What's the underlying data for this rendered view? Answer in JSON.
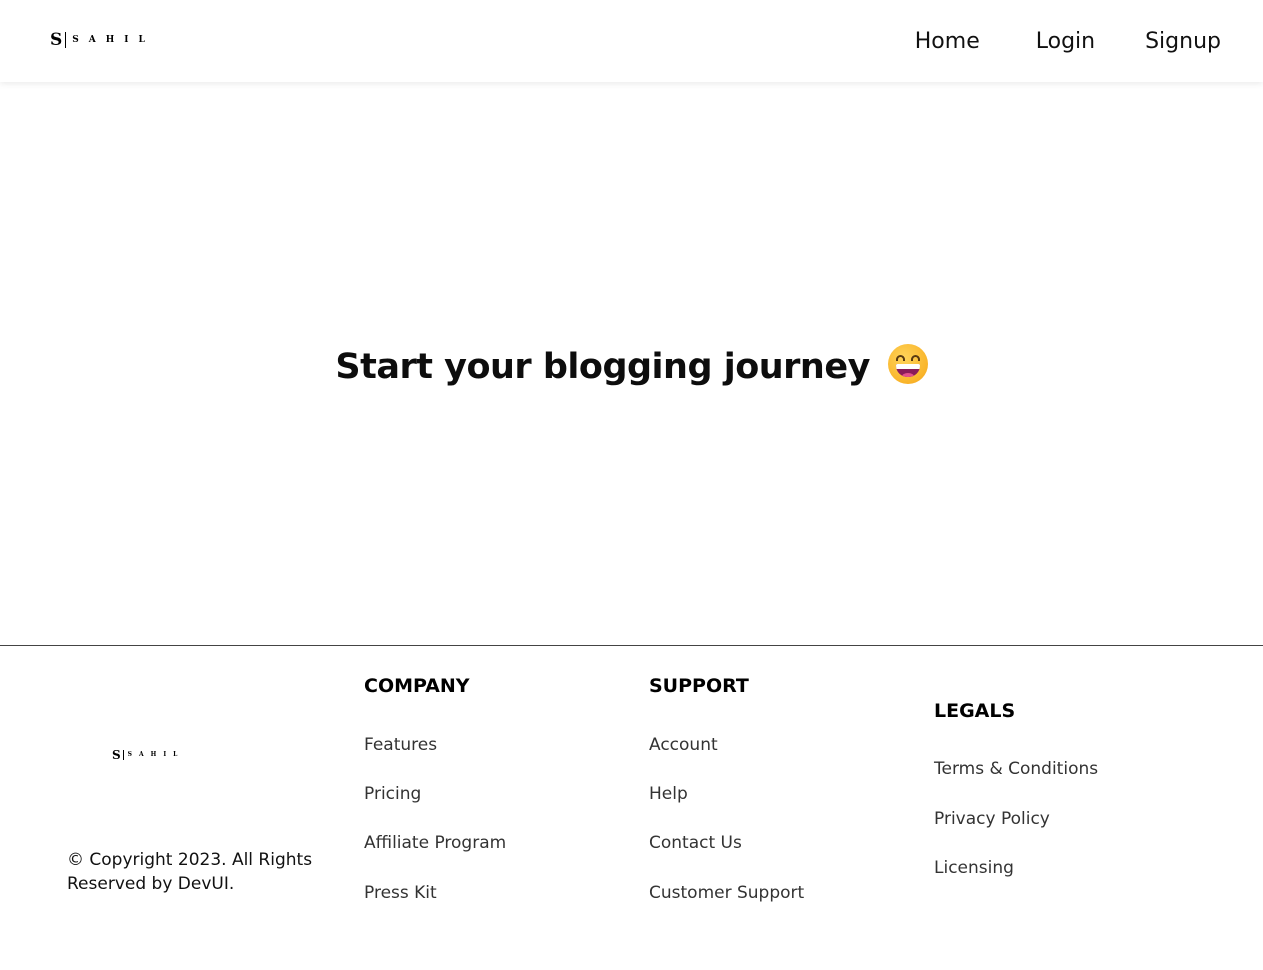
{
  "brand": {
    "initial": "S",
    "name": "SAHIL"
  },
  "nav": {
    "home": "Home",
    "login": "Login",
    "signup": "Signup"
  },
  "hero": {
    "title": "Start your blogging journey",
    "emoji_icon": "grinning-face-icon"
  },
  "footer": {
    "copyright": "© Copyright 2023. All Rights Reserved by DevUI.",
    "company": {
      "title": "COMPANY",
      "links": [
        "Features",
        "Pricing",
        "Affiliate Program",
        "Press Kit"
      ]
    },
    "support": {
      "title": "SUPPORT",
      "links": [
        "Account",
        "Help",
        "Contact Us",
        "Customer Support"
      ]
    },
    "legals": {
      "title": "LEGALS",
      "links": [
        "Terms & Conditions",
        "Privacy Policy",
        "Licensing"
      ]
    }
  },
  "colors": {
    "text": "#111111",
    "muted": "#333333",
    "background": "#ffffff",
    "emoji": "#f9b42a"
  }
}
